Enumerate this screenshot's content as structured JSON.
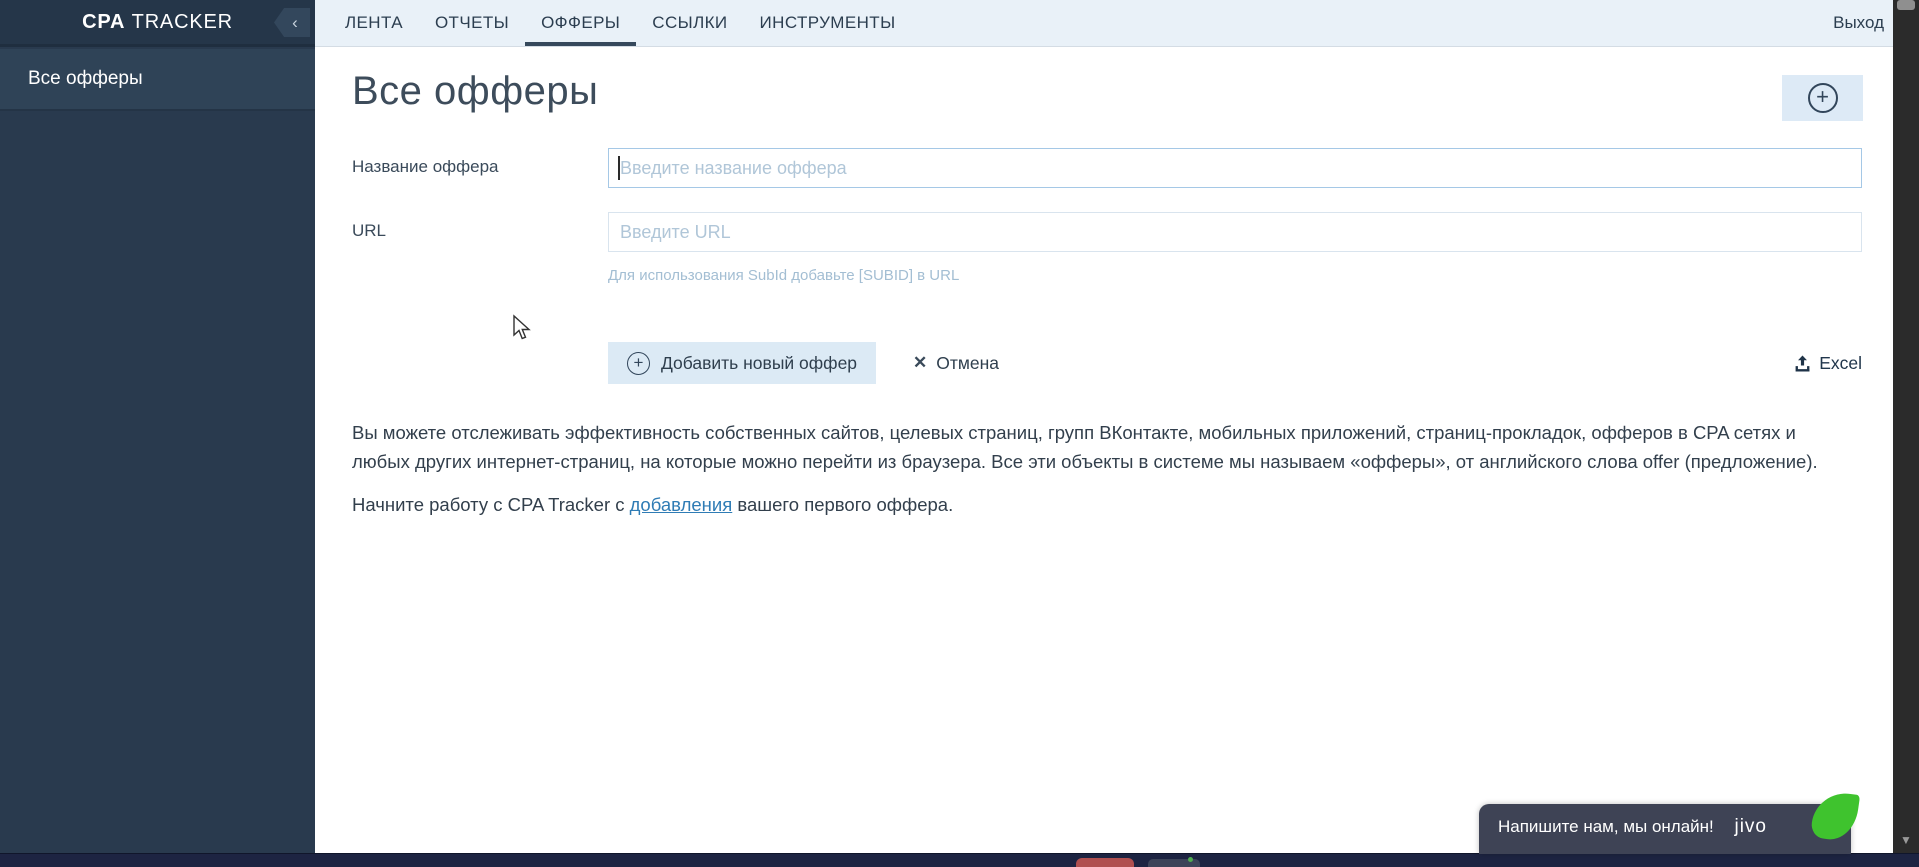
{
  "app": {
    "logo_bold": "CPA",
    "logo_rest": "TRACKER"
  },
  "icons": {
    "collapse": "‹",
    "add": "+",
    "close": "✕",
    "scroll_down": "▼"
  },
  "sidebar": {
    "items": [
      {
        "label": "Все офферы",
        "active": true
      }
    ]
  },
  "topnav": {
    "tabs": [
      {
        "label": "ЛЕНТА"
      },
      {
        "label": "ОТЧЕТЫ"
      },
      {
        "label": "ОФФЕРЫ"
      },
      {
        "label": "ССЫЛКИ"
      },
      {
        "label": "ИНСТРУМЕНТЫ"
      }
    ],
    "active_tab": "ОФФЕРЫ",
    "logout_label": "Выход"
  },
  "main": {
    "title": "Все офферы",
    "form": {
      "name_label": "Название оффера",
      "name_placeholder": "Введите название оффера",
      "url_label": "URL",
      "url_placeholder": "Введите URL",
      "url_hint": "Для использования SubId добавьте [SUBID] в URL",
      "submit_label": "Добавить новый оффер",
      "cancel_label": "Отмена",
      "excel_label": "Excel"
    },
    "description_p1": "Вы можете отслеживать эффективность собственных сайтов, целевых страниц, групп ВКонтакте, мобильных приложений, страниц-прокладок, офферов в CPA сетях и любых других интернет-страниц, на которые можно перейти из браузера. Все эти объекты в системе мы называем «офферы», от английского слова offer (предложение).",
    "description_p2_before": "Начните работу с CPA Tracker с ",
    "description_p2_link": "добавления",
    "description_p2_after": " вашего первого оффера."
  },
  "chat": {
    "message": "Напишите нам, мы онлайн!",
    "brand": "jivo"
  },
  "colors": {
    "sidebar_bg": "#293a4e",
    "sidebar_header_bg": "#253649",
    "sidebar_active_bg": "#2f4357",
    "topbar_bg": "#e9f1f8",
    "tab_text": "#2c3e50",
    "active_tab_underline": "#36495c",
    "accent_button_bg": "#dceaf5",
    "focused_input_border": "#a5c8e6",
    "input_border": "#d9e4ee",
    "placeholder_text": "#b0c6d8",
    "hint_text": "#a3bed3",
    "link": "#2f7cb5",
    "chat_bg": "#3e4355",
    "chat_leaf_green": "#3fc32e",
    "taskbar_bg": "#1d2442",
    "scrollbar_track": "#2b2b2b"
  }
}
